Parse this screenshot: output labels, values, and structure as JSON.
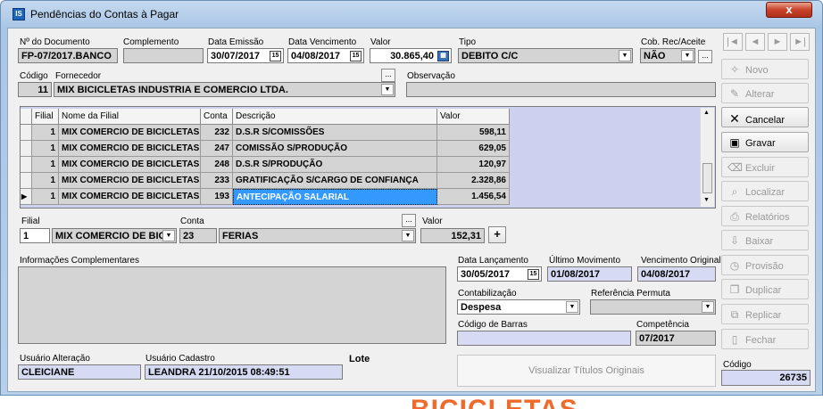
{
  "window": {
    "title": "Pendências do Contas à Pagar",
    "close_label": "x",
    "icon_label": "IS"
  },
  "doc": {
    "num_label": "Nº do Documento",
    "num_value": "FP-07/2017.BANCO",
    "comp_label": "Complemento",
    "comp_value": "",
    "emissao_label": "Data Emissão",
    "emissao_value": "30/07/2017",
    "venc_label": "Data Vencimento",
    "venc_value": "04/08/2017",
    "valor_label": "Valor",
    "valor_value": "30.865,40",
    "tipo_label": "Tipo",
    "tipo_value": "DEBITO C/C",
    "cob_label": "Cob. Rec/Aceite",
    "cob_value": "NÃO"
  },
  "fornecedor": {
    "codigo_label": "Código",
    "forn_label": "Fornecedor",
    "codigo_value": "11",
    "nome_value": "MIX BICICLETAS INDUSTRIA E COMERCIO LTDA.",
    "obs_label": "Observação",
    "obs_value": ""
  },
  "grid": {
    "headers": {
      "filial": "Filial",
      "nome": "Nome da Filial",
      "conta": "Conta",
      "descricao": "Descrição",
      "valor": "Valor"
    },
    "rows": [
      {
        "filial": "1",
        "nome": "MIX COMERCIO DE BICICLETAS",
        "conta": "232",
        "descricao": "D.S.R S/COMISSÕES",
        "valor": "598,11"
      },
      {
        "filial": "1",
        "nome": "MIX COMERCIO DE BICICLETAS",
        "conta": "247",
        "descricao": "COMISSÃO S/PRODUÇÃO",
        "valor": "629,05"
      },
      {
        "filial": "1",
        "nome": "MIX COMERCIO DE BICICLETAS",
        "conta": "248",
        "descricao": "D.S.R S/PRODUÇÃO",
        "valor": "120,97"
      },
      {
        "filial": "1",
        "nome": "MIX COMERCIO DE BICICLETAS",
        "conta": "233",
        "descricao": "GRATIFICAÇÃO S/CARGO DE CONFIANÇA",
        "valor": "2.328,86"
      },
      {
        "filial": "1",
        "nome": "MIX COMERCIO DE BICICLETAS",
        "conta": "193",
        "descricao": "ANTECIPAÇÃO SALARIAL",
        "valor": "1.456,54"
      }
    ]
  },
  "item": {
    "filial_label": "Filial",
    "filial_code": "1",
    "filial_name": "MIX COMERCIO DE BIC",
    "conta_label": "Conta",
    "conta_code": "23",
    "conta_name": "FERIAS",
    "valor_label": "Valor",
    "valor_value": "152,31",
    "add_label": "+",
    "ellipsis": "..."
  },
  "info": {
    "label": "Informações Complementares",
    "value": ""
  },
  "dates": {
    "lanc_label": "Data Lançamento",
    "lanc_value": "30/05/2017",
    "ultimo_label": "Último Movimento",
    "ultimo_value": "01/08/2017",
    "vorig_label": "Vencimento Original",
    "vorig_value": "04/08/2017",
    "contab_label": "Contabilização",
    "contab_value": "Despesa",
    "refperm_label": "Referência Permuta",
    "refperm_value": "",
    "barras_label": "Código de Barras",
    "barras_value": "",
    "comp_label": "Competência",
    "comp_value": "07/2017"
  },
  "users": {
    "alt_label": "Usuário Alteração",
    "alt_value": "CLEICIANE",
    "cad_label": "Usuário Cadastro",
    "cad_value": "LEANDRA 21/10/2015 08:49:51",
    "lote_label": "Lote"
  },
  "view_btn": "Visualizar Títulos Originais",
  "codigo": {
    "label": "Código",
    "value": "26735"
  },
  "nav": {
    "first": "|◄",
    "prev": "◄",
    "next": "►",
    "last": "►|"
  },
  "side": {
    "novo": "Novo",
    "alterar": "Alterar",
    "cancelar": "Cancelar",
    "gravar": "Gravar",
    "excluir": "Excluir",
    "localizar": "Localizar",
    "relatorios": "Relatórios",
    "baixar": "Baixar",
    "provisao": "Provisão",
    "duplicar": "Duplicar",
    "replicar": "Replicar",
    "fechar": "Fechar"
  },
  "background_text": "BICICLETAS"
}
